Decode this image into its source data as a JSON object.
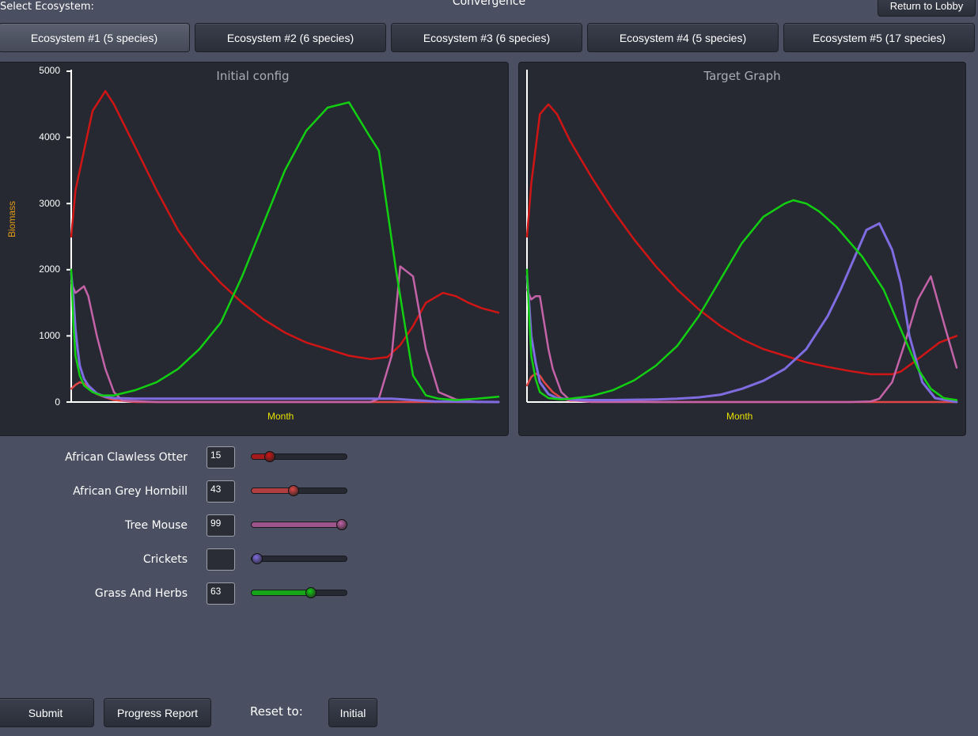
{
  "header": {
    "select_label": "Select Ecosystem:",
    "title": "Convergence",
    "lobby_button": "Return to Lobby"
  },
  "tabs": [
    {
      "label": "Ecosystem #1 (5 species)",
      "active": true
    },
    {
      "label": "Ecosystem #2 (6 species)",
      "active": false
    },
    {
      "label": "Ecosystem #3 (6 species)",
      "active": false
    },
    {
      "label": "Ecosystem #4 (5 species)",
      "active": false
    },
    {
      "label": "Ecosystem #5 (17 species)",
      "active": false
    }
  ],
  "colors": {
    "otter": "#d01515",
    "hornbill": "#e04646",
    "mouse": "#c463a8",
    "crickets": "#7f6ce0",
    "grass": "#12cf12",
    "xlabel": "#e9e200",
    "ylabel": "#e09a16"
  },
  "chart_data": [
    {
      "type": "line",
      "title": "Initial config",
      "xlabel": "Month",
      "ylabel": "Biomass",
      "ylim": [
        0,
        5000
      ],
      "yticks": [
        "5000",
        "4000",
        "3000",
        "2000",
        "1000",
        "0"
      ],
      "xlim": [
        0,
        1
      ],
      "series": [
        {
          "key": "otter",
          "x": [
            0,
            0.01,
            0.05,
            0.08,
            0.1,
            0.15,
            0.2,
            0.25,
            0.3,
            0.35,
            0.4,
            0.45,
            0.5,
            0.55,
            0.6,
            0.65,
            0.7,
            0.74,
            0.77,
            0.8,
            0.83,
            0.87,
            0.9,
            0.93,
            0.96,
            1.0
          ],
          "y": [
            2500,
            3200,
            4400,
            4700,
            4500,
            3850,
            3200,
            2600,
            2150,
            1800,
            1500,
            1250,
            1050,
            900,
            800,
            700,
            650,
            680,
            860,
            1150,
            1500,
            1650,
            1600,
            1500,
            1420,
            1350
          ]
        },
        {
          "key": "hornbill",
          "x": [
            0,
            0.01,
            0.02,
            0.03,
            0.04,
            0.05,
            0.06,
            0.08,
            0.1,
            0.15,
            0.5,
            0.75,
            0.8,
            1.0
          ],
          "y": [
            200,
            260,
            300,
            280,
            220,
            170,
            120,
            70,
            30,
            0,
            0,
            0,
            0,
            0
          ]
        },
        {
          "key": "mouse",
          "x": [
            0,
            0.01,
            0.02,
            0.03,
            0.04,
            0.05,
            0.06,
            0.08,
            0.1,
            0.12,
            0.2,
            0.7,
            0.72,
            0.75,
            0.77,
            0.8,
            0.83,
            0.86,
            0.9,
            0.95,
            1.0
          ],
          "y": [
            1800,
            1650,
            1700,
            1750,
            1600,
            1300,
            1000,
            500,
            150,
            20,
            0,
            0,
            50,
            700,
            2050,
            1900,
            800,
            150,
            40,
            0,
            0
          ]
        },
        {
          "key": "crickets",
          "x": [
            0,
            0.005,
            0.01,
            0.015,
            0.02,
            0.03,
            0.04,
            0.06,
            0.08,
            0.1,
            0.15,
            0.5,
            0.75,
            0.8,
            0.85,
            1.0
          ],
          "y": [
            1950,
            1600,
            1100,
            800,
            550,
            350,
            250,
            130,
            80,
            60,
            50,
            50,
            50,
            30,
            10,
            0
          ],
          "width": 3
        },
        {
          "key": "grass",
          "x": [
            0,
            0.005,
            0.01,
            0.02,
            0.03,
            0.05,
            0.07,
            0.1,
            0.15,
            0.2,
            0.25,
            0.3,
            0.35,
            0.4,
            0.45,
            0.5,
            0.55,
            0.6,
            0.65,
            0.7,
            0.72,
            0.76,
            0.8,
            0.83,
            0.86,
            0.9,
            0.95,
            1.0
          ],
          "y": [
            2000,
            1200,
            700,
            400,
            250,
            150,
            100,
            100,
            180,
            300,
            500,
            800,
            1200,
            1900,
            2700,
            3500,
            4100,
            4450,
            4530,
            4000,
            3800,
            2000,
            400,
            100,
            50,
            30,
            50,
            80
          ]
        }
      ]
    },
    {
      "type": "line",
      "title": "Target Graph",
      "xlabel": "Month",
      "ylabel": "",
      "ylim": [
        0,
        5000
      ],
      "yticks": [],
      "xlim": [
        0,
        1
      ],
      "series": [
        {
          "key": "otter",
          "x": [
            0,
            0.01,
            0.03,
            0.05,
            0.07,
            0.1,
            0.15,
            0.2,
            0.25,
            0.3,
            0.35,
            0.4,
            0.45,
            0.5,
            0.55,
            0.6,
            0.65,
            0.7,
            0.75,
            0.8,
            0.85,
            0.87,
            0.9,
            0.93,
            0.96,
            1.0
          ],
          "y": [
            2500,
            3300,
            4350,
            4500,
            4350,
            3950,
            3400,
            2900,
            2450,
            2050,
            1700,
            1400,
            1150,
            950,
            800,
            700,
            600,
            530,
            470,
            420,
            420,
            460,
            600,
            750,
            900,
            1000
          ]
        },
        {
          "key": "hornbill",
          "x": [
            0,
            0.01,
            0.02,
            0.03,
            0.04,
            0.06,
            0.08,
            0.1,
            0.3,
            0.7,
            0.8,
            0.85,
            1.0
          ],
          "y": [
            250,
            380,
            430,
            400,
            300,
            150,
            60,
            20,
            0,
            0,
            0,
            0,
            0
          ]
        },
        {
          "key": "mouse",
          "x": [
            0,
            0.01,
            0.02,
            0.03,
            0.04,
            0.05,
            0.06,
            0.08,
            0.1,
            0.15,
            0.5,
            0.75,
            0.8,
            0.82,
            0.85,
            0.88,
            0.91,
            0.94,
            0.97,
            1.0
          ],
          "y": [
            1700,
            1550,
            1600,
            1600,
            1200,
            800,
            500,
            150,
            30,
            0,
            0,
            0,
            10,
            50,
            300,
            900,
            1550,
            1900,
            1200,
            520
          ]
        },
        {
          "key": "crickets",
          "x": [
            0,
            0.005,
            0.01,
            0.02,
            0.03,
            0.05,
            0.07,
            0.1,
            0.15,
            0.2,
            0.3,
            0.35,
            0.4,
            0.45,
            0.5,
            0.55,
            0.6,
            0.65,
            0.7,
            0.73,
            0.76,
            0.79,
            0.82,
            0.85,
            0.87,
            0.89,
            0.92,
            0.95,
            1.0
          ],
          "y": [
            1900,
            1500,
            1000,
            600,
            300,
            120,
            60,
            40,
            30,
            30,
            40,
            50,
            70,
            110,
            200,
            320,
            500,
            800,
            1300,
            1700,
            2150,
            2600,
            2700,
            2300,
            1800,
            1000,
            300,
            60,
            0
          ],
          "width": 3
        },
        {
          "key": "grass",
          "x": [
            0,
            0.005,
            0.01,
            0.02,
            0.03,
            0.05,
            0.08,
            0.1,
            0.15,
            0.2,
            0.25,
            0.3,
            0.35,
            0.4,
            0.45,
            0.5,
            0.55,
            0.6,
            0.62,
            0.65,
            0.68,
            0.72,
            0.78,
            0.83,
            0.87,
            0.91,
            0.94,
            0.97,
            1.0
          ],
          "y": [
            2000,
            1300,
            700,
            350,
            150,
            60,
            40,
            50,
            90,
            180,
            330,
            550,
            850,
            1300,
            1850,
            2400,
            2800,
            3000,
            3050,
            3000,
            2880,
            2650,
            2200,
            1700,
            1100,
            500,
            200,
            60,
            30
          ]
        }
      ]
    }
  ],
  "species": [
    {
      "name": "African Clawless Otter",
      "value": "15",
      "level": 0.15,
      "key": "otter"
    },
    {
      "name": "African Grey Hornbill",
      "value": "43",
      "level": 0.43,
      "key": "hornbill"
    },
    {
      "name": "Tree Mouse",
      "value": "99",
      "level": 0.99,
      "key": "mouse"
    },
    {
      "name": "Crickets",
      "value": "",
      "level": 0.0,
      "key": "crickets"
    },
    {
      "name": "Grass And Herbs",
      "value": "63",
      "level": 0.63,
      "key": "grass"
    }
  ],
  "footer": {
    "submit": "Submit",
    "progress": "Progress Report",
    "reset_label": "Reset to:",
    "initial": "Initial"
  }
}
